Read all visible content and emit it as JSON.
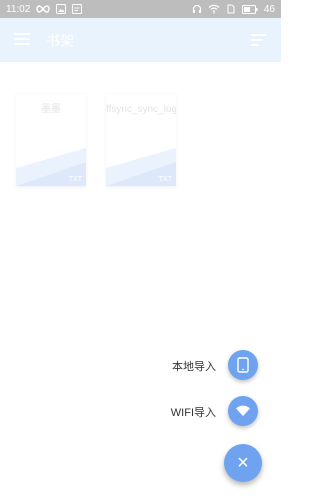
{
  "status_bar": {
    "time": "11:02",
    "battery": "46"
  },
  "header": {
    "title": "书架"
  },
  "books": [
    {
      "title": "墨墨",
      "ext": "TXT"
    },
    {
      "title": "ffsync_sync_log",
      "ext": "TXT"
    }
  ],
  "fab_menu": {
    "local_import_label": "本地导入",
    "wifi_import_label": "WIFI导入",
    "close_label": "×"
  },
  "colors": {
    "accent": "#6fa3ef",
    "status_bar": "#bdbdbd",
    "header_bg": "#e9f3fe"
  }
}
